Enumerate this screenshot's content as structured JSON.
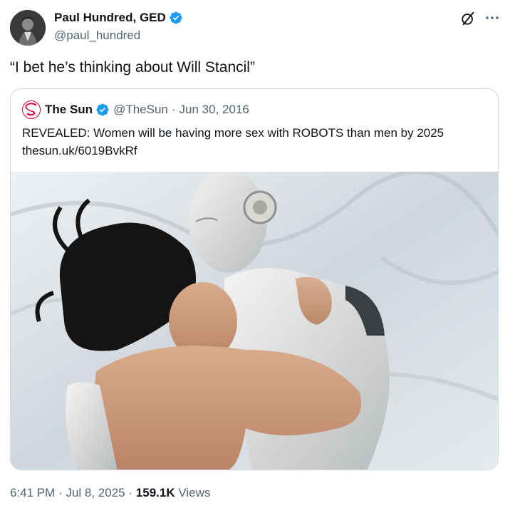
{
  "author": {
    "name": "Paul Hundred, GED",
    "handle": "@paul_hundred",
    "verified_color": "#1d9bf0"
  },
  "icons": {
    "grok": "grok-icon",
    "more": "more-icon"
  },
  "tweet": {
    "text": "“I bet he’s thinking about Will Stancil”"
  },
  "quoted": {
    "name": "The Sun",
    "handle": "@TheSun",
    "separator": "·",
    "date": "Jun 30, 2016",
    "text": "REVEALED: Women will be having more sex with ROBOTS than men by 2025",
    "link": "thesun.uk/6019BvkRf",
    "logo_color": "#e4002b"
  },
  "footer": {
    "time": "6:41 PM",
    "separator": "·",
    "date": "Jul 8, 2025",
    "separator2": "·",
    "views_count": "159.1K",
    "views_label": "Views"
  }
}
